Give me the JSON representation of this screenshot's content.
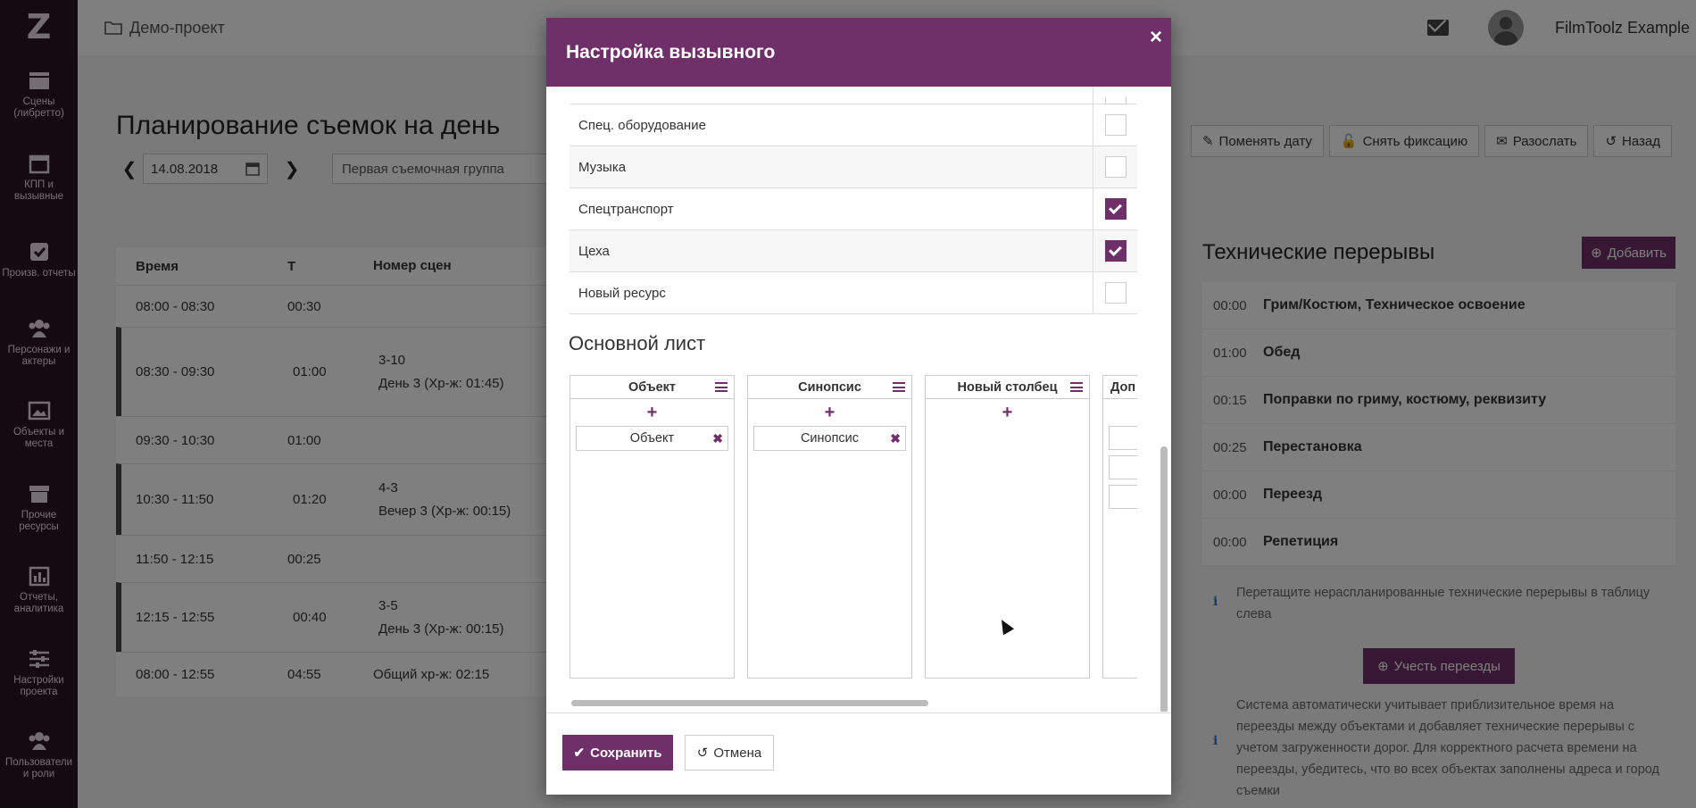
{
  "sidebar": {
    "logo": "Z",
    "items": [
      {
        "label": "Сцены (либретто)",
        "icon": "clapperboard-icon"
      },
      {
        "label": "КПП и вызывные",
        "icon": "calendar-icon"
      },
      {
        "label": "Произв. отчеты",
        "icon": "checkbox-icon"
      },
      {
        "label": "Персонажи и актеры",
        "icon": "users-icon"
      },
      {
        "label": "Объекты и места",
        "icon": "image-icon"
      },
      {
        "label": "Прочие ресурсы",
        "icon": "archive-icon"
      },
      {
        "label": "Отчеты, аналитика",
        "icon": "bar-chart-icon"
      },
      {
        "label": "Настройки проекта",
        "icon": "sliders-icon"
      },
      {
        "label": "Пользователи и роли",
        "icon": "users-icon"
      }
    ]
  },
  "topbar": {
    "project": "Демо-проект",
    "user": "FilmToolz Example"
  },
  "page": {
    "title": "Планирование съемок на день",
    "date": "14.08.2018",
    "group": "Первая съемочная группа",
    "actions": [
      "Поменять дату",
      "Снять фиксацию",
      "Разослать",
      "Назад"
    ]
  },
  "schedule": {
    "headers": [
      "Время",
      "Т",
      "Номер сцен"
    ],
    "rows": [
      {
        "time": "08:00 - 08:30",
        "t": "00:30",
        "scene": "",
        "scene2": "",
        "dark": false
      },
      {
        "time": "08:30 - 09:30",
        "t": "01:00",
        "scene": "3-10",
        "scene2": "День 3 (Хр-ж: 01:45)",
        "dark": true
      },
      {
        "time": "09:30 - 10:30",
        "t": "01:00",
        "scene": "",
        "scene2": "",
        "dark": false
      },
      {
        "time": "10:30 - 11:50",
        "t": "01:20",
        "scene": "4-3",
        "scene2": "Вечер 3 (Хр-ж: 00:15)",
        "dark": true
      },
      {
        "time": "11:50 - 12:15",
        "t": "00:25",
        "scene": "",
        "scene2": "",
        "dark": false
      },
      {
        "time": "12:15 - 12:55",
        "t": "00:40",
        "scene": "3-5",
        "scene2": "День 3 (Хр-ж: 00:15)",
        "dark": true
      },
      {
        "time": "08:00 - 12:55",
        "t": "04:55",
        "scene": "Общий хр-ж: 02:15",
        "scene2": "",
        "dark": false
      }
    ]
  },
  "breaks": {
    "title": "Технические перерывы",
    "add_label": "Добавить",
    "items": [
      {
        "dur": "00:00",
        "name": "Грим/Костюм, Техническое освоение"
      },
      {
        "dur": "01:00",
        "name": "Обед"
      },
      {
        "dur": "00:15",
        "name": "Поправки по гриму, костюму, реквизиту"
      },
      {
        "dur": "00:25",
        "name": "Перестановка"
      },
      {
        "dur": "00:00",
        "name": "Переезд"
      },
      {
        "dur": "00:00",
        "name": "Репетиция"
      }
    ],
    "hint": "Перетащите нераспланированные технические перерывы в таблицу слева",
    "consider_label": "Учесть переезды",
    "note": "Система автоматически учитывает приблизительное время на переезды между объектами и добавляет технические перерывы с учетом загруженности дорог. Для корректного расчета времени на переезды, убедитесь, что во всех объектах заполнены адреса и город съемки"
  },
  "modal": {
    "title": "Настройка вызывного",
    "close": "×",
    "resources": [
      {
        "label": "Спец. оборудование",
        "checked": false
      },
      {
        "label": "Музыка",
        "checked": false
      },
      {
        "label": "Спецтранспорт",
        "checked": true
      },
      {
        "label": "Цеха",
        "checked": true
      },
      {
        "label": "Новый ресурс",
        "checked": false
      }
    ],
    "section": "Основной лист",
    "columns": [
      {
        "title": "Объект",
        "chip": "Объект"
      },
      {
        "title": "Синопсис",
        "chip": "Синопсис"
      },
      {
        "title": "Новый столбец",
        "chip": ""
      },
      {
        "title": "Доп",
        "chip": ""
      }
    ],
    "plus": "+",
    "remove": "✖",
    "save_label": "Сохранить",
    "cancel_label": "Отмена"
  }
}
